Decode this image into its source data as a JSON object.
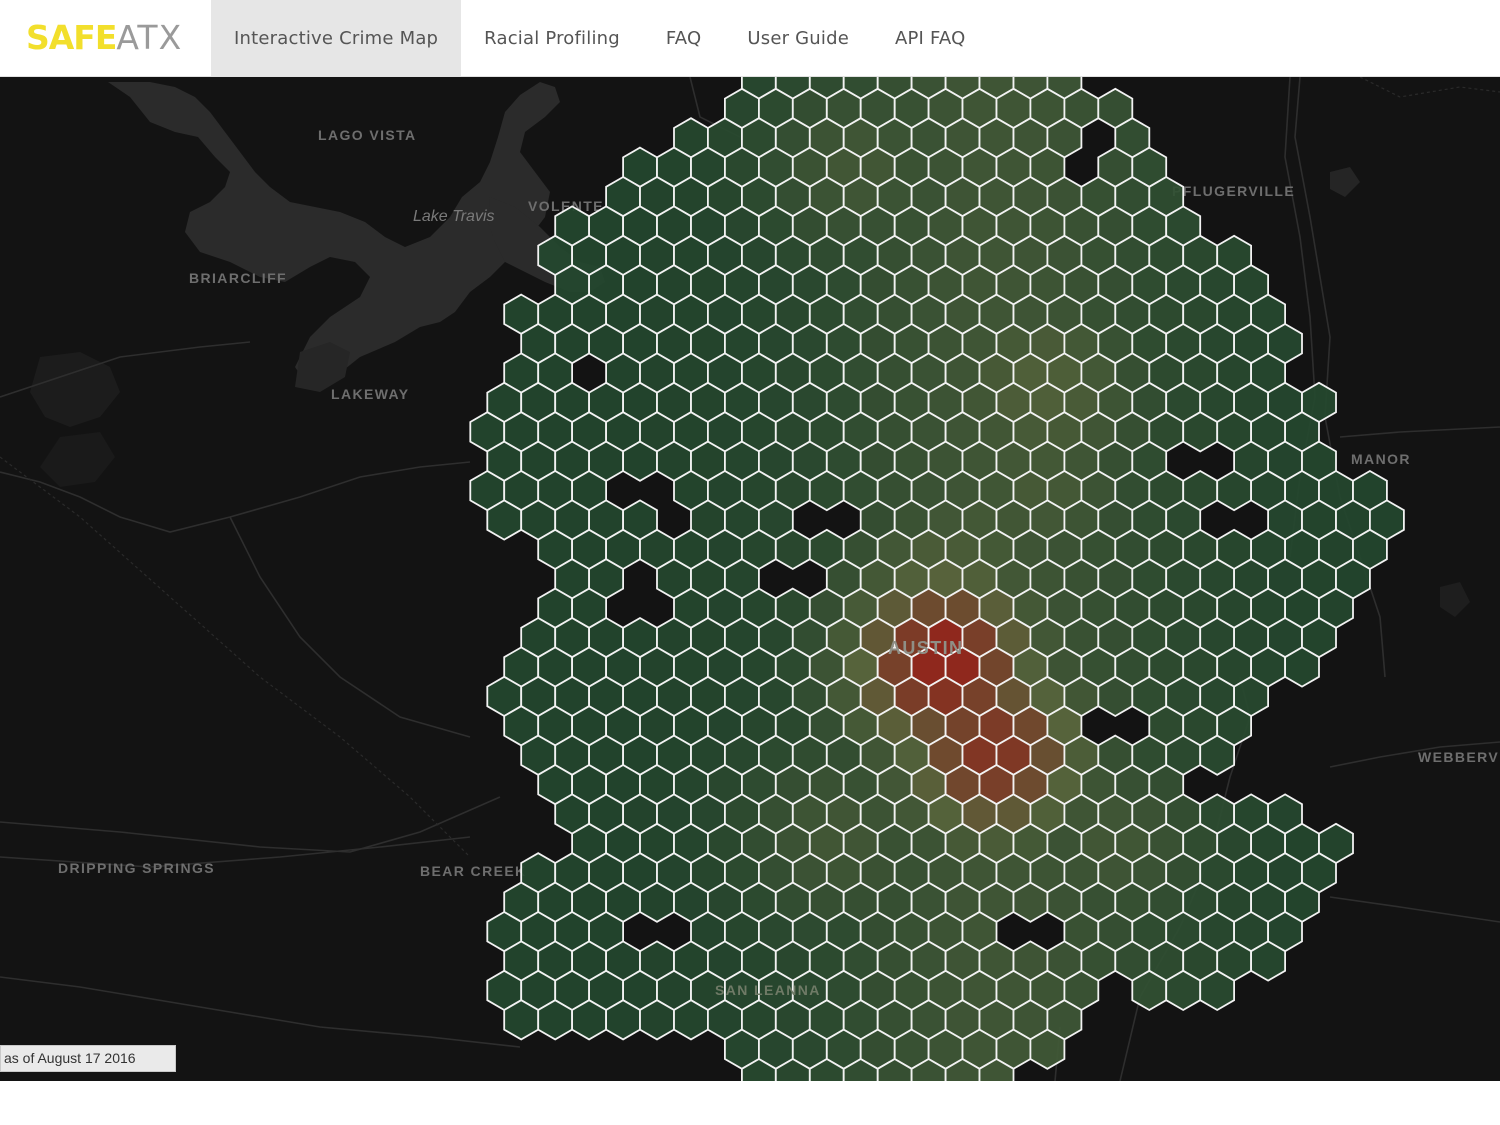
{
  "brand": {
    "part1": "SAFE",
    "part2": "ATX",
    "colors": {
      "part1": "#f2df2c",
      "part2": "#9a9a9a"
    }
  },
  "nav": {
    "items": [
      {
        "label": "Interactive Crime Map",
        "active": true
      },
      {
        "label": "Racial Profiling",
        "active": false
      },
      {
        "label": "FAQ",
        "active": false
      },
      {
        "label": "User Guide",
        "active": false
      },
      {
        "label": "API FAQ",
        "active": false
      }
    ]
  },
  "map": {
    "places": {
      "lago_vista": "LAGO VISTA",
      "lake_travis": "Lake Travis",
      "volente": "VOLENTE",
      "pflugerville": "PFLUGERVILLE",
      "briarcliff": "BRIARCLIFF",
      "lakeway": "LAKEWAY",
      "manor": "MANOR",
      "austin": "AUSTIN",
      "webberville": "WEBBERV",
      "dripping_springs": "DRIPPING SPRINGS",
      "bear_creek": "BEAR CREEK",
      "sunset_valley": "SAN LEANNA"
    },
    "hexbin_colors": {
      "low": "#24482f",
      "mid": "#5c6a3f",
      "high": "#9a2a1e",
      "outline": "#f2f2f2"
    },
    "attribution": "as of August 17 2016"
  }
}
